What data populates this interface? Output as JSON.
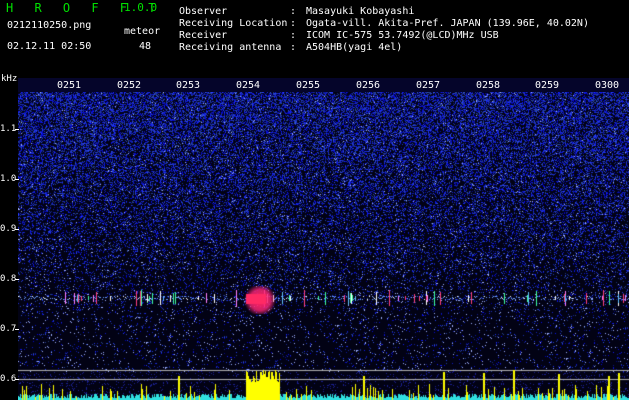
{
  "header": {
    "app_name": "H R O F F T",
    "app_version": "1.0.0",
    "filename": "0212110250.png",
    "datetime": "02.12.11 02:50",
    "meteor_label": "meteor",
    "meteor_count": "48",
    "info": [
      {
        "key": "Observer",
        "value": "Masayuki Kobayashi"
      },
      {
        "key": "Receiving Location",
        "value": "Ogata-vill. Akita-Pref. JAPAN (139.96E, 40.02N)"
      },
      {
        "key": "Receiver",
        "value": "ICOM IC-575 53.7492(@LCD)MHz USB"
      },
      {
        "key": "Receiving antenna",
        "value": "A504HB(yagi 4el)"
      }
    ],
    "separator": ":"
  },
  "axes": {
    "y_unit": "kHz",
    "y_ticks": [
      "1.1",
      "1.0",
      "0.9",
      "0.8",
      "0.7",
      "0.6"
    ],
    "x_ticks": [
      "0251",
      "0252",
      "0253",
      "0254",
      "0255",
      "0256",
      "0257",
      "0258",
      "0259",
      "0300"
    ]
  },
  "colors": {
    "background": "#000000",
    "noise": "#2830c8",
    "echo": "#ff3060",
    "meteor_bar": "#ffff00",
    "baseline": "#30e0e0",
    "title_green": "#00e000"
  }
}
